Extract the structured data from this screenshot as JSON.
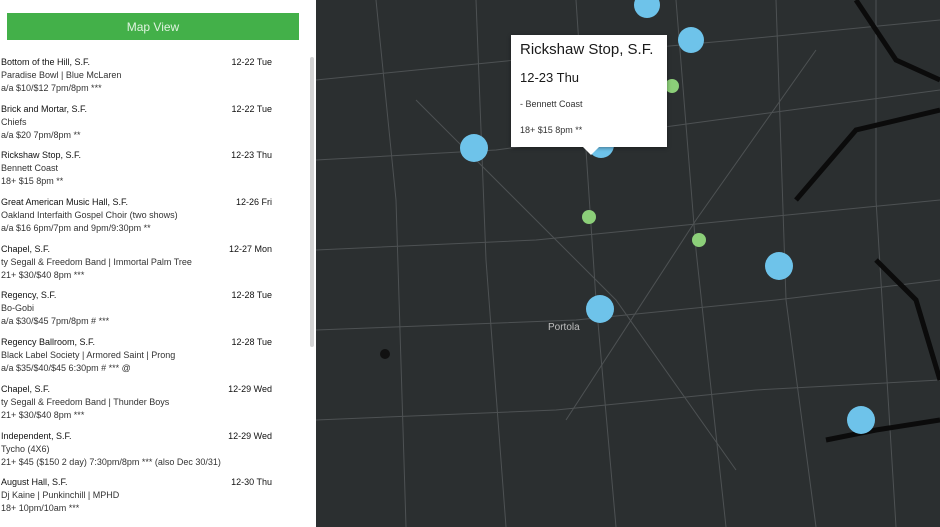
{
  "sidebar": {
    "button_label": "Map View",
    "events": [
      {
        "venue": "Bottom of the Hill, S.F.",
        "date": "12-22 Tue",
        "band": "Paradise Bowl | Blue McLaren",
        "price": "a/a $10/$12 7pm/8pm ***"
      },
      {
        "venue": "Brick and Mortar, S.F.",
        "date": "12-22 Tue",
        "band": "Chiefs",
        "price": "a/a $20 7pm/8pm **"
      },
      {
        "venue": "Rickshaw Stop, S.F.",
        "date": "12-23 Thu",
        "band": "Bennett Coast",
        "price": "18+ $15 8pm **"
      },
      {
        "venue": "Great American Music Hall, S.F.",
        "date": "12-26 Fri",
        "band": "Oakland Interfaith Gospel Choir (two shows)",
        "price": "a/a $16 6pm/7pm and 9pm/9:30pm **"
      },
      {
        "venue": "Chapel, S.F.",
        "date": "12-27 Mon",
        "band": "ty Segall & Freedom Band | Immortal Palm Tree",
        "price": "21+ $30/$40 8pm ***"
      },
      {
        "venue": "Regency, S.F.",
        "date": "12-28 Tue",
        "band": "Bo-Gobi",
        "price": "a/a $30/$45 7pm/8pm # ***"
      },
      {
        "venue": "Regency Ballroom, S.F.",
        "date": "12-28 Tue",
        "band": "Black Label Society | Armored Saint | Prong",
        "price": "a/a $35/$40/$45 6:30pm # *** @"
      },
      {
        "venue": "Chapel, S.F.",
        "date": "12-29 Wed",
        "band": "ty Segall & Freedom Band | Thunder Boys",
        "price": "21+ $30/$40 8pm ***"
      },
      {
        "venue": "Independent, S.F.",
        "date": "12-29 Wed",
        "band": "Tycho (4X6)",
        "price": "21+ $45 ($150 2 day) 7:30pm/8pm *** (also Dec 30/31)"
      },
      {
        "venue": "August Hall, S.F.",
        "date": "12-30 Thu",
        "band": "Dj Kaine | Punkinchill | MPHD",
        "price": "18+ 10pm/10am ***"
      }
    ]
  },
  "popup": {
    "venue": "Rickshaw Stop, S.F.",
    "date": "12-23 Thu",
    "band": "Bennett Coast",
    "price": "18+ $15 8pm **"
  },
  "map": {
    "labels": [
      "Portola"
    ],
    "colors": {
      "blue_marker": "#6ec3ea",
      "green_marker": "#8ccf79",
      "dark_marker": "#111111",
      "map_bg": "#2b2f30",
      "button": "#43b049"
    }
  }
}
